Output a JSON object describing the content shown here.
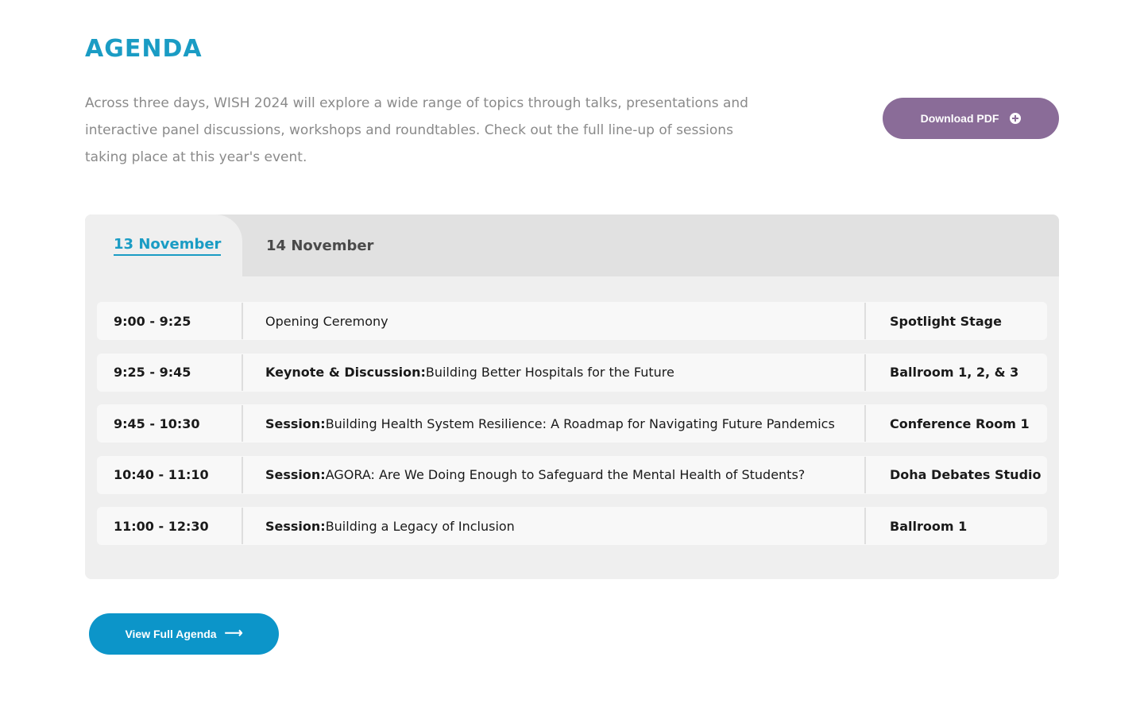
{
  "header": {
    "title": "AGENDA",
    "intro": "Across three days, WISH 2024 will explore a wide range of topics through talks, presentations and interactive panel discussions, workshops and roundtables.  Check out the full line-up of sessions taking place at this year's event.",
    "download_label": "Download PDF",
    "download_icon": "plus-circle-icon"
  },
  "tabs": [
    {
      "label": "13 November",
      "active": true
    },
    {
      "label": "14 November",
      "active": false
    }
  ],
  "sessions": [
    {
      "time": "9:00 - 9:25",
      "label": "",
      "title": "Opening Ceremony",
      "location": "Spotlight Stage"
    },
    {
      "time": "9:25 - 9:45",
      "label": "Keynote & Discussion:",
      "title": " Building Better Hospitals for the Future",
      "location": "Ballroom 1, 2, & 3"
    },
    {
      "time": "9:45 - 10:30",
      "label": "Session:",
      "title": " Building Health System Resilience: A Roadmap for Navigating Future Pandemics",
      "location": "Conference Room 1"
    },
    {
      "time": "10:40 - 11:10",
      "label": "Session:",
      "title": " AGORA: Are We Doing Enough to Safeguard the Mental Health of Students?",
      "location": "Doha Debates Studio"
    },
    {
      "time": "11:00 - 12:30",
      "label": "Session:",
      "title": " Building a Legacy of Inclusion",
      "location": "Ballroom 1"
    }
  ],
  "footer": {
    "view_agenda_label": "View Full Agenda",
    "view_agenda_icon": "arrow-right-icon"
  },
  "colors": {
    "accent_blue": "#1a9cc4",
    "button_blue": "#0c95c9",
    "button_purple": "#8a6c98"
  }
}
